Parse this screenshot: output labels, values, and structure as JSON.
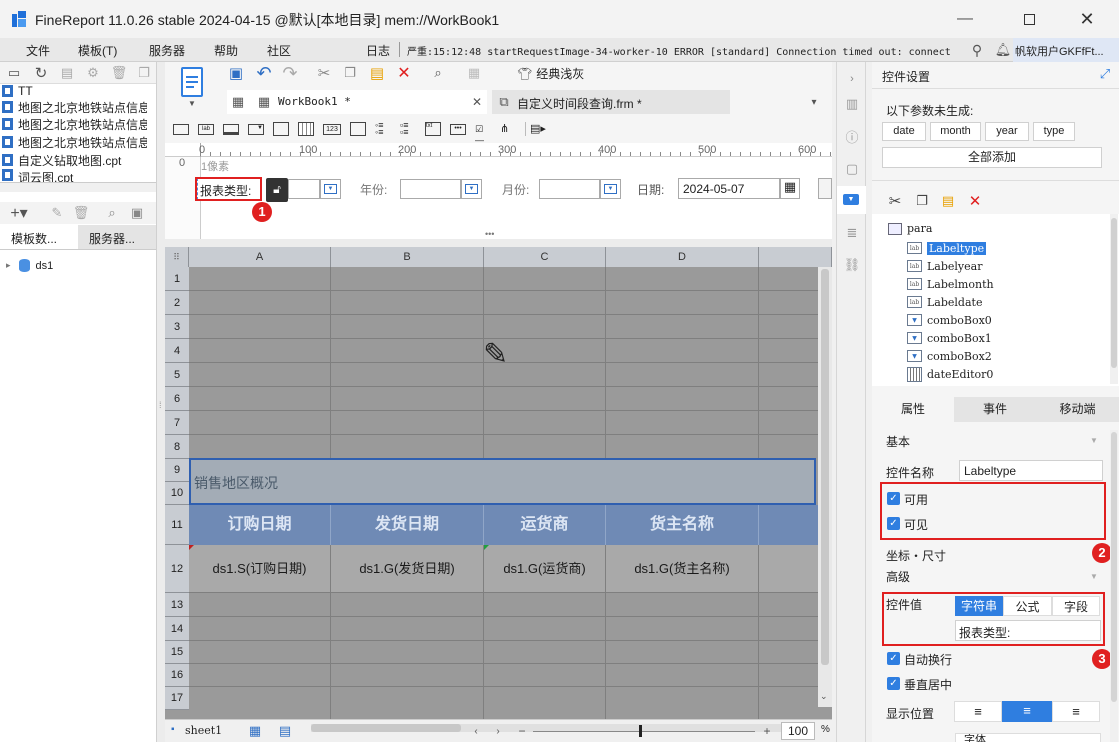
{
  "window": {
    "title": "FineReport 11.0.26 stable 2024-04-15 @默认[本地目录]    mem://WorkBook1"
  },
  "menu": {
    "items": [
      "文件",
      "模板(T)",
      "服务器",
      "帮助",
      "社区"
    ],
    "log_label": "日志",
    "log_text": "严重:15:12:48 startRequestImage-34-worker-10 ERROR [standard] Connection timed out: connect",
    "user": "帆软用户GKFfFt..."
  },
  "left": {
    "files": [
      "TT",
      "地图之北京地铁站点信息",
      "地图之北京地铁站点信息",
      "地图之北京地铁站点信息",
      "自定义钻取地图.cpt",
      "词云图.cpt"
    ],
    "tabs": [
      "模板数...",
      "服务器..."
    ],
    "dataset": "ds1"
  },
  "tabs": [
    {
      "label": "WorkBook1 *"
    },
    {
      "label": "自定义时间段查询.frm *"
    }
  ],
  "toolbar": {
    "style_label": "经典浅灰"
  },
  "ruler": {
    "ticks": [
      "0",
      "100",
      "200",
      "300",
      "400",
      "500",
      "600"
    ],
    "unit": "1像素"
  },
  "param": {
    "label_type": "报表类型:",
    "year_label": "年份:",
    "month_label": "月份:",
    "date_label": "日期:",
    "date_value": "2024-05-07"
  },
  "sheet": {
    "columns": [
      "A",
      "B",
      "C",
      "D"
    ],
    "rows": [
      "1",
      "2",
      "3",
      "4",
      "5",
      "6",
      "7",
      "8",
      "9",
      "10",
      "11",
      "12",
      "13",
      "14",
      "15",
      "16",
      "17"
    ],
    "title": "销售地区概况",
    "headers": [
      "订购日期",
      "发货日期",
      "运货商",
      "货主名称"
    ],
    "cells": [
      "ds1.S(订购日期)",
      "ds1.G(发货日期)",
      "ds1.G(运货商)",
      "ds1.G(货主名称)"
    ],
    "sheet_tab": "sheet1",
    "zoom": "100",
    "zoom_unit": "%"
  },
  "props": {
    "title": "控件设置",
    "params_note": "以下参数未生成:",
    "params": [
      "date",
      "month",
      "year",
      "type"
    ],
    "add_all": "全部添加",
    "widget_root": "para",
    "widgets": [
      {
        "name": "Labeltype",
        "kind": "lab",
        "selected": true
      },
      {
        "name": "Labelyear",
        "kind": "lab"
      },
      {
        "name": "Labelmonth",
        "kind": "lab"
      },
      {
        "name": "Labeldate",
        "kind": "lab"
      },
      {
        "name": "comboBox0",
        "kind": "combo"
      },
      {
        "name": "comboBox1",
        "kind": "combo"
      },
      {
        "name": "comboBox2",
        "kind": "combo"
      },
      {
        "name": "dateEditor0",
        "kind": "date"
      }
    ],
    "prop_tabs": [
      "属性",
      "事件",
      "移动端"
    ],
    "basic": "基本",
    "name_label": "控件名称",
    "name_value": "Labeltype",
    "enabled": "可用",
    "visible": "可见",
    "coord": "坐标・尺寸",
    "advanced": "高级",
    "value_label": "控件值",
    "value_types": [
      "字符串",
      "公式",
      "字段"
    ],
    "value_text": "报表类型:",
    "wrap": "自动换行",
    "valign": "垂直居中",
    "display_pos": "显示位置",
    "font_label": "字体"
  },
  "annotations": [
    "1",
    "2",
    "3"
  ],
  "colors": {
    "accent": "#2f7ee0",
    "header_blue": "#6f8ab5",
    "title_band": "#a3acb6",
    "red": "#e02020"
  }
}
